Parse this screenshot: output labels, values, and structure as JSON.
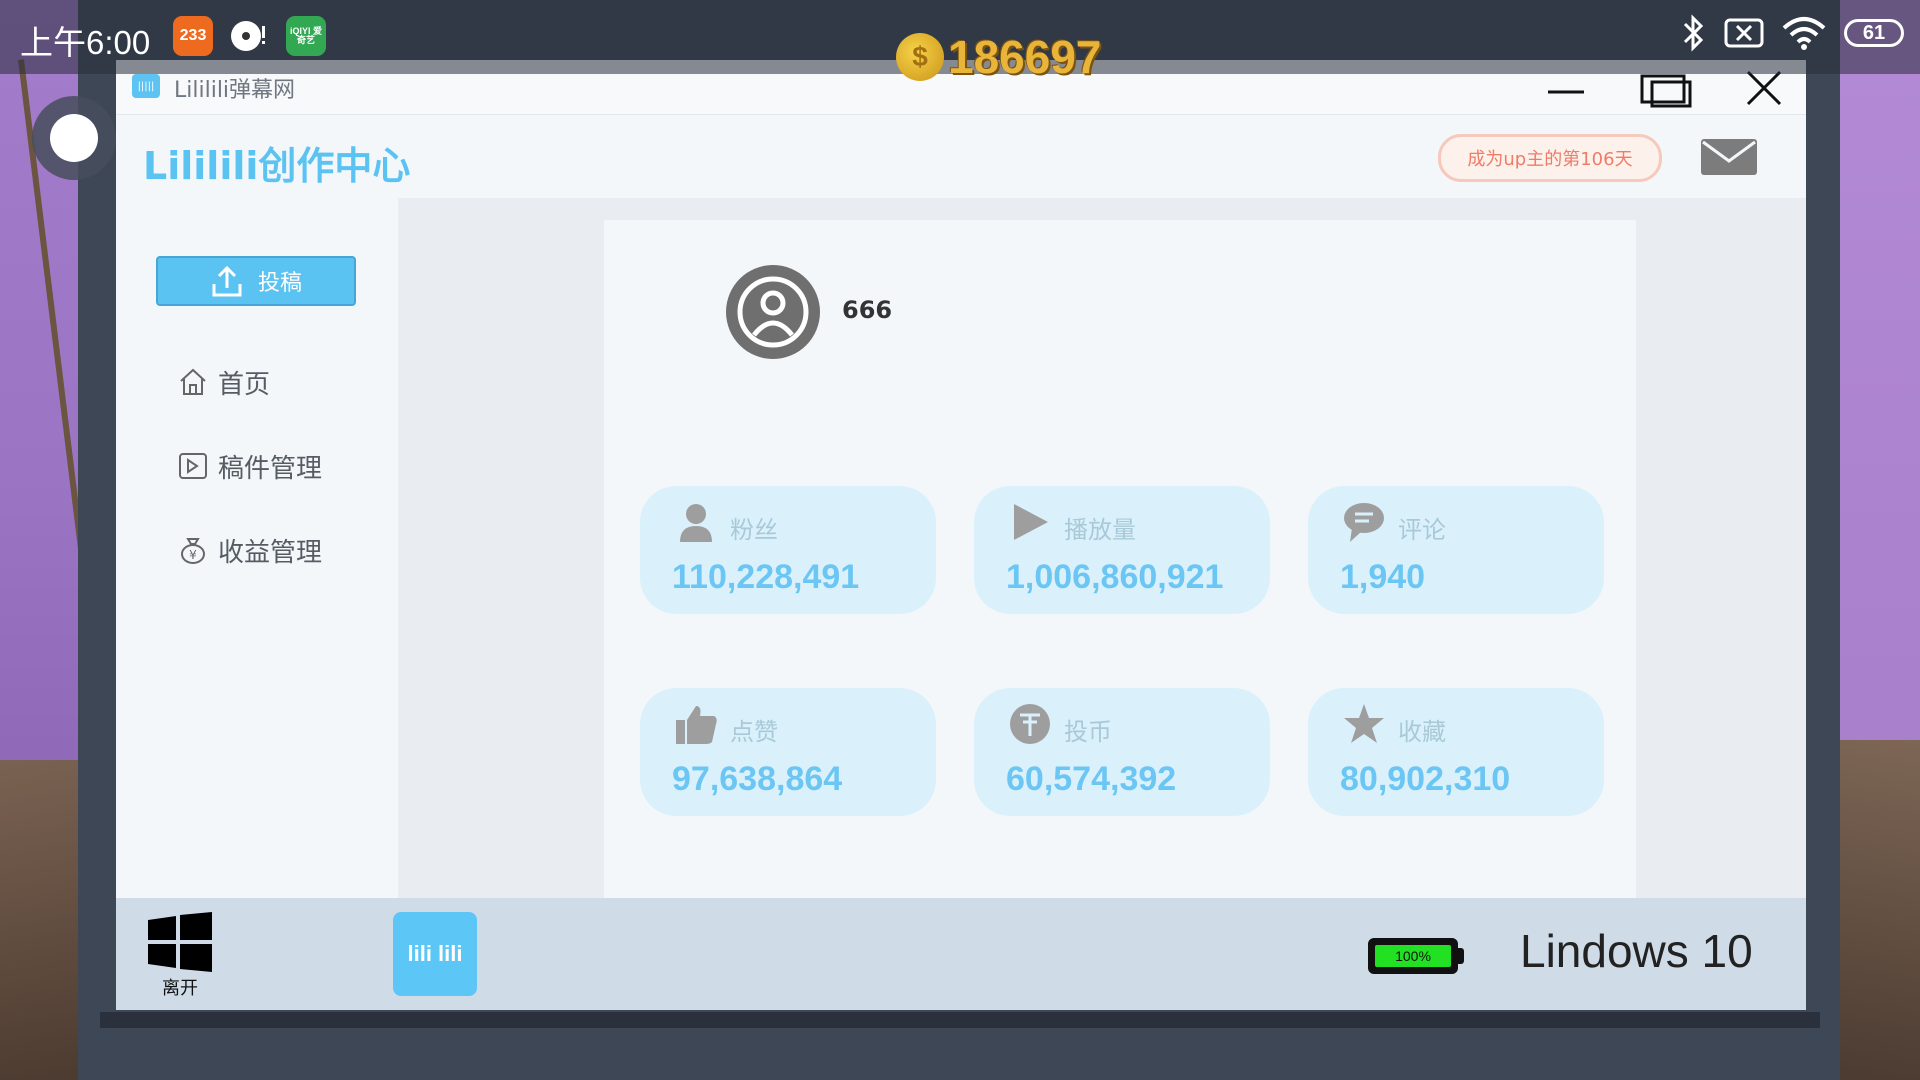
{
  "status_bar": {
    "time": "上午6:00",
    "apps": [
      {
        "icon": "233-app-icon",
        "label": "233"
      },
      {
        "icon": "music-app-icon",
        "label": ""
      },
      {
        "icon": "iqiyi-app-icon",
        "label": "iQIYI 爱奇艺"
      }
    ],
    "battery_level": "61"
  },
  "coins": {
    "value": "186697"
  },
  "window": {
    "title": "Lililili弹幕网"
  },
  "header": {
    "title": "Lililili创作中心",
    "badge": "成为up主的第106天"
  },
  "sidebar": {
    "submit_label": "投稿",
    "items": [
      {
        "label": "首页",
        "icon": "home-icon"
      },
      {
        "label": "稿件管理",
        "icon": "video-manage-icon"
      },
      {
        "label": "收益管理",
        "icon": "money-bag-icon"
      }
    ]
  },
  "profile": {
    "username": "666"
  },
  "stats": [
    {
      "label": "粉丝",
      "value": "110,228,491",
      "icon": "fans-icon"
    },
    {
      "label": "播放量",
      "value": "1,006,860,921",
      "icon": "play-icon"
    },
    {
      "label": "评论",
      "value": "1,940",
      "icon": "comment-icon"
    },
    {
      "label": "点赞",
      "value": "97,638,864",
      "icon": "like-icon"
    },
    {
      "label": "投币",
      "value": "60,574,392",
      "icon": "coin-icon"
    },
    {
      "label": "收藏",
      "value": "80,902,310",
      "icon": "star-icon"
    }
  ],
  "taskbar": {
    "start_label": "离开",
    "app_label": "lili lili",
    "battery_percent": "100%",
    "battery_level": 1.0,
    "os_name": "Lindows 10"
  },
  "colors": {
    "accent": "#5bc3f2",
    "stat_card": "#daf1fc",
    "badge_text": "#ef7c67",
    "battery_fill": "#22e022"
  }
}
